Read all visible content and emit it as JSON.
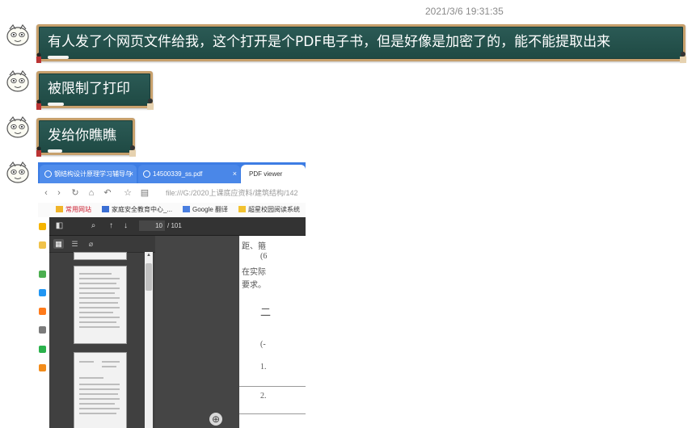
{
  "chat": {
    "timestamp": "2021/3/6 19:31:35",
    "messages": [
      {
        "text": "有人发了个网页文件给我，这个打开是个PDF电子书，但是好像是加密了的，能不能提取出来"
      },
      {
        "text": "被限制了打印"
      },
      {
        "text": "发给你瞧瞧"
      }
    ]
  },
  "screenshot": {
    "tabs": [
      {
        "label": "钢结构设计原理学习辅导与",
        "close": "×"
      },
      {
        "label": "14500339_ss.pdf",
        "close": "×"
      },
      {
        "label": "PDF viewer"
      }
    ],
    "address": "file:///G:/2020上课底应资料/建筑结构/142",
    "bookmarks": [
      "常用网站",
      "家庭安全教育中心_...",
      "Google 翻译",
      "超星校园阅读系统"
    ],
    "viewer": {
      "page_current": "10",
      "page_total": "/ 101"
    },
    "page_text": [
      "距、箍",
      "(6",
      "在实际",
      "要求。",
      "二",
      "(-",
      "1.",
      "2."
    ],
    "colors": {
      "tabbar": "#3d7de4",
      "bubble": "#2b5a55",
      "bubble_border": "#c7a06c"
    }
  }
}
